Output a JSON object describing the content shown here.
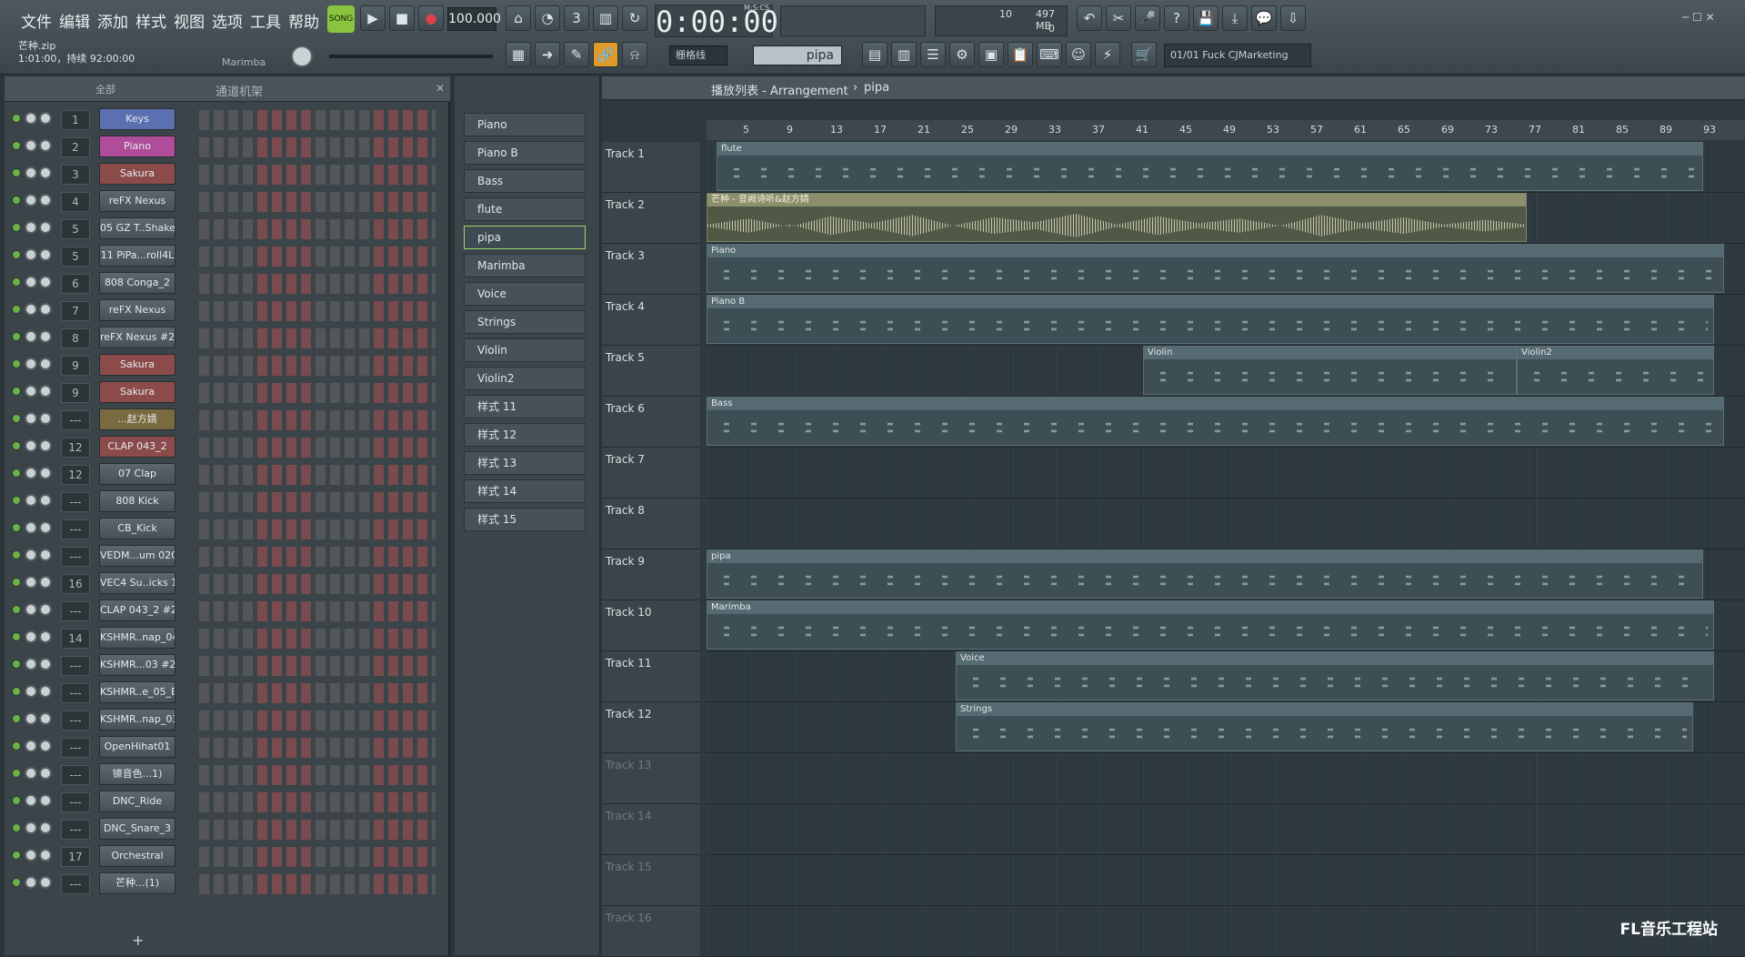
{
  "menu": [
    "文件",
    "编辑",
    "添加",
    "样式",
    "视图",
    "选项",
    "工具",
    "帮助"
  ],
  "transport": {
    "mode": "SONG",
    "tempo": "100.000",
    "time": "0:00:00",
    "time_unit": "M:S:CS",
    "cpu": "10",
    "memory": "497 MB",
    "voices": "0"
  },
  "hint": {
    "file": "芒种.zip",
    "info": "1:01:00，持续 92:00:00",
    "channel": "Marimba"
  },
  "snap": "栅格线",
  "pattern_selector": "pipa",
  "news": "01/01  Fuck CJMarketing",
  "rack": {
    "filter": "全部",
    "title": "通道机架",
    "add": "+"
  },
  "channels": [
    {
      "num": "1",
      "name": "Keys",
      "color": "#5c6fb0"
    },
    {
      "num": "2",
      "name": "Piano",
      "color": "#b04d9b"
    },
    {
      "num": "3",
      "name": "Sakura",
      "color": "#8c4b4b"
    },
    {
      "num": "4",
      "name": "reFX Nexus",
      "color": ""
    },
    {
      "num": "5",
      "name": "05 GZ T..Shake3",
      "color": ""
    },
    {
      "num": "5",
      "name": "11 PiPa...roll4L",
      "color": ""
    },
    {
      "num": "6",
      "name": "808 Conga_2",
      "color": ""
    },
    {
      "num": "7",
      "name": "reFX Nexus",
      "color": ""
    },
    {
      "num": "8",
      "name": "reFX Nexus #2",
      "color": ""
    },
    {
      "num": "9",
      "name": "Sakura",
      "color": "#8c4b4b"
    },
    {
      "num": "9",
      "name": "Sakura",
      "color": "#8c4b4b"
    },
    {
      "num": "---",
      "name": "...赵方婧",
      "color": "#7a6a40"
    },
    {
      "num": "12",
      "name": "CLAP 043_2",
      "color": "#8c4b4b"
    },
    {
      "num": "12",
      "name": "07 Clap",
      "color": ""
    },
    {
      "num": "---",
      "name": "808 Kick",
      "color": ""
    },
    {
      "num": "---",
      "name": "CB_Kick",
      "color": ""
    },
    {
      "num": "---",
      "name": "VEDM...um 020",
      "color": ""
    },
    {
      "num": "16",
      "name": "VEC4 Su..icks 11",
      "color": ""
    },
    {
      "num": "---",
      "name": "CLAP 043_2 #2",
      "color": ""
    },
    {
      "num": "14",
      "name": "KSHMR..nap_04",
      "color": ""
    },
    {
      "num": "---",
      "name": "KSHMR...03 #2",
      "color": ""
    },
    {
      "num": "---",
      "name": "KSHMR..e_05_E",
      "color": ""
    },
    {
      "num": "---",
      "name": "KSHMR..nap_03",
      "color": ""
    },
    {
      "num": "---",
      "name": "OpenHihat01",
      "color": ""
    },
    {
      "num": "---",
      "name": "镲音色...1)",
      "color": ""
    },
    {
      "num": "---",
      "name": "DNC_Ride",
      "color": ""
    },
    {
      "num": "---",
      "name": "DNC_Snare_3",
      "color": ""
    },
    {
      "num": "17",
      "name": "Orchestral",
      "color": ""
    },
    {
      "num": "---",
      "name": "芒种...(1)",
      "color": ""
    }
  ],
  "patterns": [
    "Piano",
    "Piano B",
    "Bass",
    "flute",
    "pipa",
    "Marimba",
    "Voice",
    "Strings",
    "Violin",
    "Violin2",
    "样式 11",
    "样式 12",
    "样式 13",
    "样式 14",
    "样式 15"
  ],
  "playlist": {
    "title": "播放列表 - Arrangement",
    "arrow": "›",
    "current": "pipa"
  },
  "ruler": [
    "5",
    "9",
    "13",
    "17",
    "21",
    "25",
    "29",
    "33",
    "37",
    "41",
    "45",
    "49",
    "53",
    "57",
    "61",
    "65",
    "69",
    "73",
    "77",
    "81",
    "85",
    "89",
    "93"
  ],
  "tracks": [
    {
      "name": "Track 1",
      "clips": [
        {
          "title": "flute",
          "start": 0.01,
          "end": 0.96
        }
      ]
    },
    {
      "name": "Track 2",
      "clips": [
        {
          "title": "芒种 - 音阙诗听&赵方婧",
          "start": 0.0,
          "end": 0.79,
          "audio": true
        }
      ]
    },
    {
      "name": "Track 3",
      "clips": [
        {
          "title": "Piano",
          "start": 0.0,
          "end": 0.98
        }
      ]
    },
    {
      "name": "Track 4",
      "clips": [
        {
          "title": "Piano B",
          "start": 0.0,
          "end": 0.97
        }
      ]
    },
    {
      "name": "Track 5",
      "clips": [
        {
          "title": "Violin",
          "start": 0.42,
          "end": 0.78
        },
        {
          "title": "Violin2",
          "start": 0.78,
          "end": 0.97
        }
      ]
    },
    {
      "name": "Track 6",
      "clips": [
        {
          "title": "Bass",
          "start": 0.0,
          "end": 0.98
        }
      ]
    },
    {
      "name": "Track 7",
      "clips": []
    },
    {
      "name": "Track 8",
      "clips": []
    },
    {
      "name": "Track 9",
      "clips": [
        {
          "title": "pipa",
          "start": 0.0,
          "end": 0.96
        }
      ]
    },
    {
      "name": "Track 10",
      "clips": [
        {
          "title": "Marimba",
          "start": 0.0,
          "end": 0.97
        }
      ]
    },
    {
      "name": "Track 11",
      "clips": [
        {
          "title": "Voice",
          "start": 0.24,
          "end": 0.97
        }
      ]
    },
    {
      "name": "Track 12",
      "clips": [
        {
          "title": "Strings",
          "start": 0.24,
          "end": 0.95
        }
      ]
    },
    {
      "name": "Track 13",
      "clips": []
    },
    {
      "name": "Track 14",
      "clips": []
    },
    {
      "name": "Track 15",
      "clips": []
    },
    {
      "name": "Track 16",
      "clips": []
    }
  ],
  "watermark": "FL音乐工程站"
}
